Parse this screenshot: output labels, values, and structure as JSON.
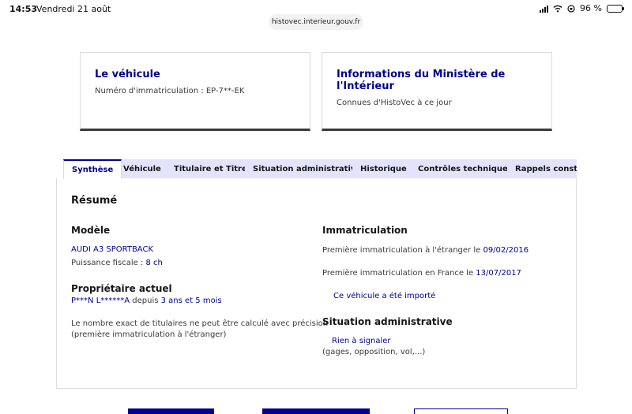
{
  "status_bar": {
    "time": "14:53",
    "date": "Vendredi 21 août",
    "battery_percent": "96 %",
    "battery_level": 0.96
  },
  "browser": {
    "url": "histovec.interieur.gouv.fr"
  },
  "cards": {
    "vehicle": {
      "title": "Le véhicule",
      "subtitle": "Numéro d'immatriculation : EP-7**-EK"
    },
    "ministry": {
      "title": "Informations du Ministère de l'Intérieur",
      "subtitle": "Connues d'HistoVec à ce jour"
    }
  },
  "tabs": [
    {
      "label": "Synthèse",
      "active": true
    },
    {
      "label": "Véhicule"
    },
    {
      "label": "Titulaire et Titre"
    },
    {
      "label": "Situation administrative"
    },
    {
      "label": "Historique"
    },
    {
      "label": "Contrôles techniques"
    },
    {
      "label": "Rappels constructeur"
    }
  ],
  "summary": {
    "heading": "Résumé",
    "model": {
      "heading": "Modèle",
      "name": "AUDI A3 SPORTBACK",
      "fiscal_label": "Puissance fiscale : ",
      "fiscal_value": "8 ch"
    },
    "owner": {
      "heading": "Propriétaire actuel",
      "name": "P***N L******A",
      "since_label": " depuis ",
      "since_value": "3 ans et 5 mois",
      "note_line1": "Le nombre exact de titulaires ne peut être calculé avec précision",
      "note_line2": "(première immatriculation à l'étranger)"
    },
    "registration": {
      "heading": "Immatriculation",
      "foreign_label": "Première immatriculation à l'étranger le ",
      "foreign_date": "09/02/2016",
      "france_label": "Première immatriculation en France le ",
      "france_date": "13/07/2017",
      "imported": "Ce véhicule a été importé"
    },
    "admin": {
      "heading": "Situation administrative",
      "status": "Rien à signaler",
      "detail": "(gages, opposition, vol,...)"
    }
  }
}
